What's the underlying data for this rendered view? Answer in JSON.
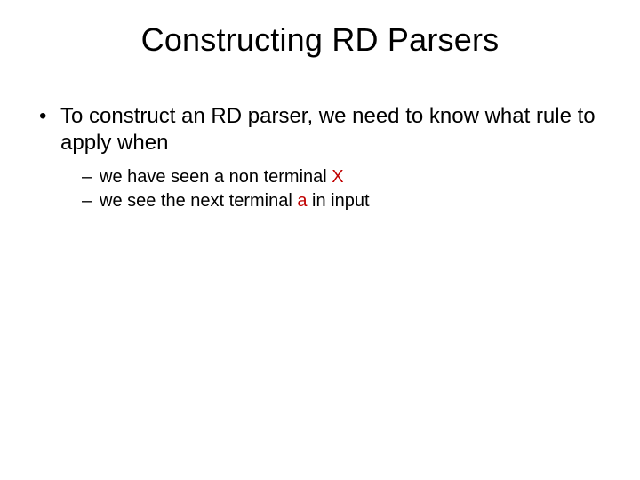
{
  "title": "Constructing RD Parsers",
  "bullets": {
    "main": "To construct an RD parser, we need to know what rule to apply when",
    "sub1_pre": "we have seen a non terminal ",
    "sub1_x": "X",
    "sub2_pre": "we see the next terminal ",
    "sub2_a": "a",
    "sub2_post": " in input"
  }
}
